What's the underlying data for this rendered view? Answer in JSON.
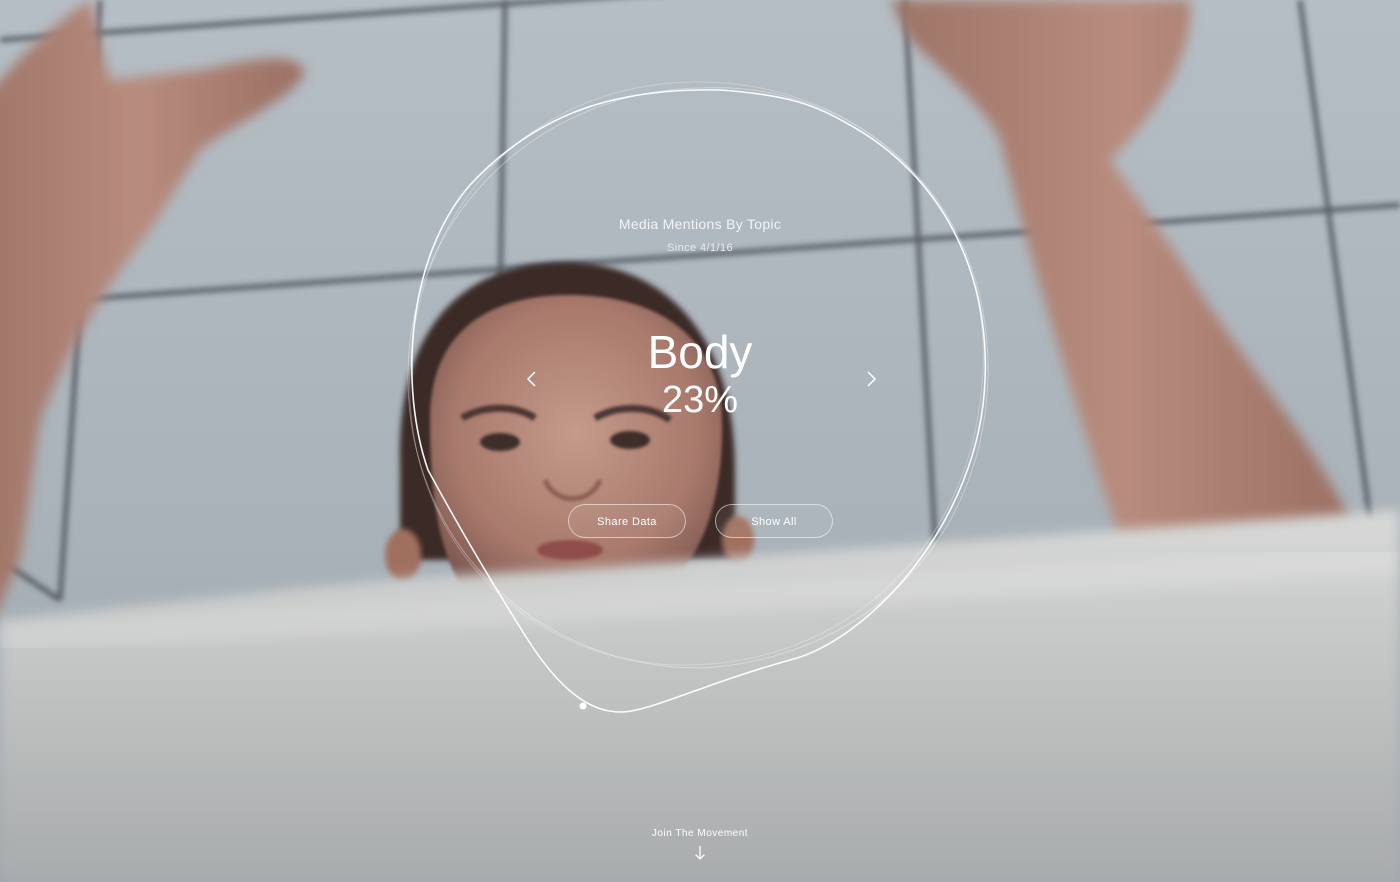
{
  "colors": {
    "text": "#ffffff",
    "sky": "#b0b9c0",
    "net": "#3a3f4a",
    "skin": "#b98d7e",
    "floor": "#d5d6d5"
  },
  "background": {
    "description_icon": "volleyball-player-photo"
  },
  "widget": {
    "title": "Media Mentions By Topic",
    "subtitle": "Since 4/1/16",
    "topic": "Body",
    "percent": "23%",
    "prev_icon": "chevron-left-icon",
    "next_icon": "chevron-right-icon",
    "share_label": "Share Data",
    "show_all_label": "Show All"
  },
  "footer": {
    "join_label": "Join The Movement",
    "arrow_icon": "arrow-down-icon"
  }
}
